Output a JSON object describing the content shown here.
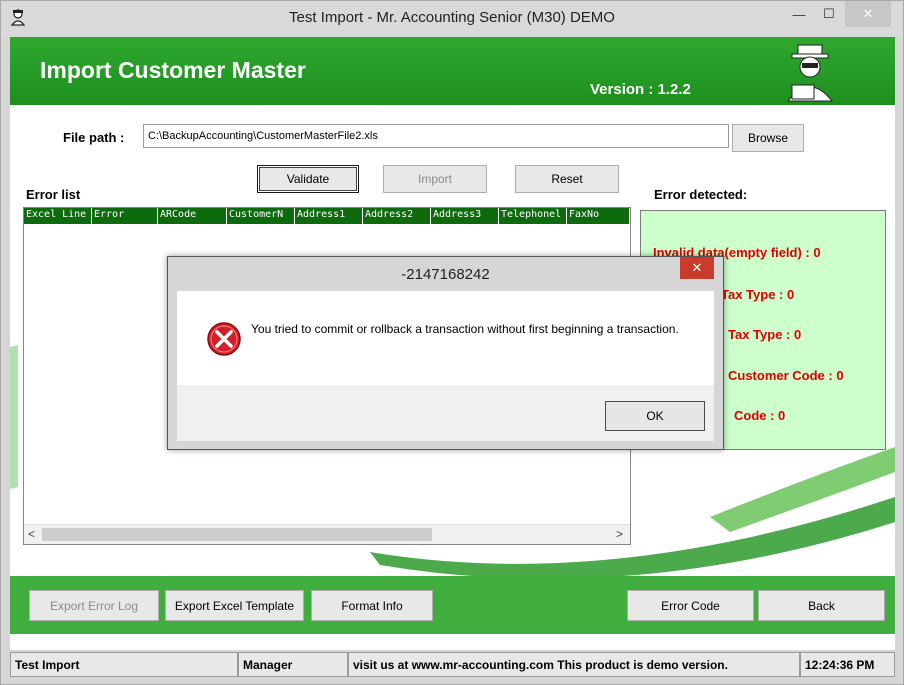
{
  "window": {
    "title": "Test Import - Mr. Accounting Senior (M30) DEMO",
    "controls": {
      "minimize": "—",
      "maximize": "☐",
      "close": "✕"
    }
  },
  "header": {
    "title": "Import Customer Master",
    "version": "Version : 1.2.2"
  },
  "file": {
    "label": "File path :",
    "value": "C:\\BackupAccounting\\CustomerMasterFile2.xls",
    "browse_label": "Browse"
  },
  "actions": {
    "validate": "Validate",
    "import": "Import",
    "reset": "Reset"
  },
  "error_list": {
    "label": "Error list",
    "columns": [
      "Excel Line",
      "Error",
      "ARCode",
      "CustomerN",
      "Address1",
      "Address2",
      "Address3",
      "Telephonel",
      "FaxNo"
    ],
    "scroll_left": "<",
    "scroll_right": ">"
  },
  "error_detected": {
    "label": "Error detected:",
    "lines": [
      "Invalid data(empty field) : 0",
      "Tax Type : 0",
      "Tax Type : 0",
      "Customer Code : 0",
      "Code : 0"
    ]
  },
  "bottom": {
    "export_error_log": "Export Error Log",
    "export_excel_template": "Export Excel Template",
    "format_info": "Format Info",
    "error_code": "Error Code",
    "back": "Back"
  },
  "status": {
    "app": "Test Import",
    "user": "Manager",
    "message": "visit us at www.mr-accounting.com This product is demo version.",
    "time": "12:24:36 PM"
  },
  "dialog": {
    "title": "-2147168242",
    "close": "✕",
    "icon": "error-icon",
    "message": "You tried to commit or rollback a transaction without first beginning a transaction.",
    "ok_label": "OK"
  },
  "colors": {
    "header_green": "#2fa82f",
    "grid_header": "#0d6a0d",
    "error_red": "#e00000",
    "panel_green": "#ccffcc"
  }
}
